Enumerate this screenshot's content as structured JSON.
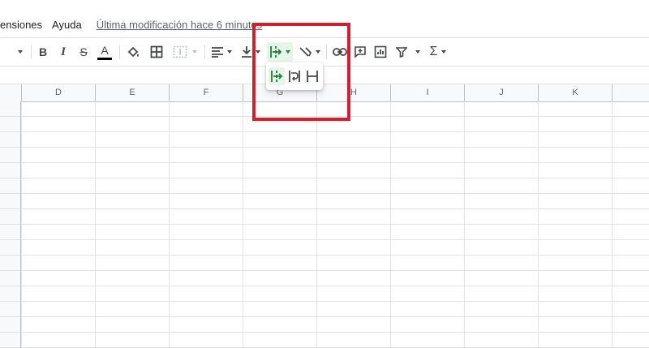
{
  "menu": {
    "items": [
      "ensiones",
      "Ayuda"
    ],
    "last_modified": "Última modificación hace 6 minutos"
  },
  "toolbar": {
    "bold": "B",
    "italic": "I",
    "strikethrough": "S",
    "text_color": "A",
    "text_color_swatch": "#000000",
    "icons": [
      "caret-down-icon",
      "bold-icon",
      "italic-icon",
      "strikethrough-icon",
      "text-color-icon",
      "fill-color-icon",
      "borders-icon",
      "merge-cells-icon",
      "horizontal-align-icon",
      "vertical-align-icon",
      "text-wrapping-icon",
      "text-rotation-icon",
      "link-icon",
      "comment-icon",
      "chart-icon",
      "filter-icon",
      "functions-icon"
    ],
    "function_symbol": "Σ"
  },
  "wrap_menu": {
    "options": [
      "overflow-icon",
      "wrap-icon",
      "clip-icon"
    ],
    "selected": "overflow-icon",
    "accent": "#188038"
  },
  "columns": [
    "D",
    "E",
    "F",
    "G",
    "H",
    "I",
    "J",
    "K"
  ],
  "highlight_color": "#d0202e"
}
